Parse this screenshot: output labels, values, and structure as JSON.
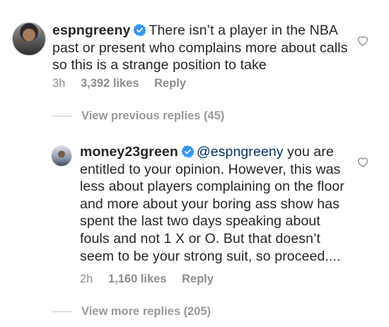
{
  "comment": {
    "username": "espngreeny",
    "text": "There isn’t a player in the NBA past or present who complains more about calls so this is a strange position to take",
    "time": "3h",
    "likes": "3,392 likes",
    "reply_label": "Reply"
  },
  "view_previous_replies": "View previous replies (45)",
  "reply": {
    "username": "money23green",
    "mention": "@espngreeny",
    "text": " you are entitled to your opinion. However, this was less about players complaining on the floor and more about your boring ass show has spent the last two days speaking about fouls and not 1 X or O. But that doesn’t seem to be your strong suit, so proceed....",
    "time": "2h",
    "likes": "1,160 likes",
    "reply_label": "Reply"
  },
  "view_more_replies": "View more replies (205)",
  "colors": {
    "verified": "#3897f0",
    "text": "#262626",
    "meta": "#8e8e8e",
    "mention": "#003569"
  },
  "icons": {
    "verified": "verified-badge-icon",
    "like": "heart-outline-icon"
  }
}
